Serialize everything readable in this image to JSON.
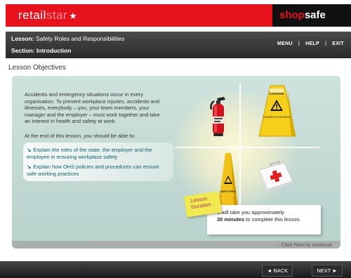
{
  "brand": {
    "logo_part1": "retail",
    "logo_part2": "star",
    "star_glyph": "★",
    "product_shop": "shop",
    "product_safe": "safe",
    "red": "#e8121c"
  },
  "lesson_bar": {
    "lesson_label": "Lesson:",
    "lesson_title": "Safety Roles and Responsibilities",
    "section_label": "Section:",
    "section_title": "Introduction",
    "nav": [
      "MENU",
      "HELP",
      "EXIT"
    ]
  },
  "page_heading": "Lesson Objectives",
  "intro_text": "Accidents and emergency situations occur in every organisation. To prevent workplace injuries, accidents and illnesses, everybody – you, your team members, your manager and the employer – must work together and take an interest in health and safety at work.",
  "at_end_text": "At the end of this lesson, you should be able to:",
  "objectives": [
    "Explain the roles of the state, the employer and the employee in ensuring workplace safety",
    "Explain how OHS policies and procedures can ensure safe working practices"
  ],
  "illustrations": {
    "caution_sign_text": "CAUTION",
    "caution_sign_subtext": "CLEANING IN PROGRESS",
    "safety_cone_text": "SAFETY FIRST",
    "icons": [
      "fire-extinguisher-icon",
      "caution-sign-icon",
      "safety-cone-icon",
      "first-aid-kit-icon"
    ]
  },
  "duration": {
    "sticky_label": "Lesson Duration",
    "text_before": "It will take you approximately",
    "minutes": "30 minutes",
    "text_after": "to complete this lesson."
  },
  "click_next": "→ Click Next to continue",
  "bottom_nav": {
    "back": "◄ BACK",
    "next": "NEXT ►"
  }
}
